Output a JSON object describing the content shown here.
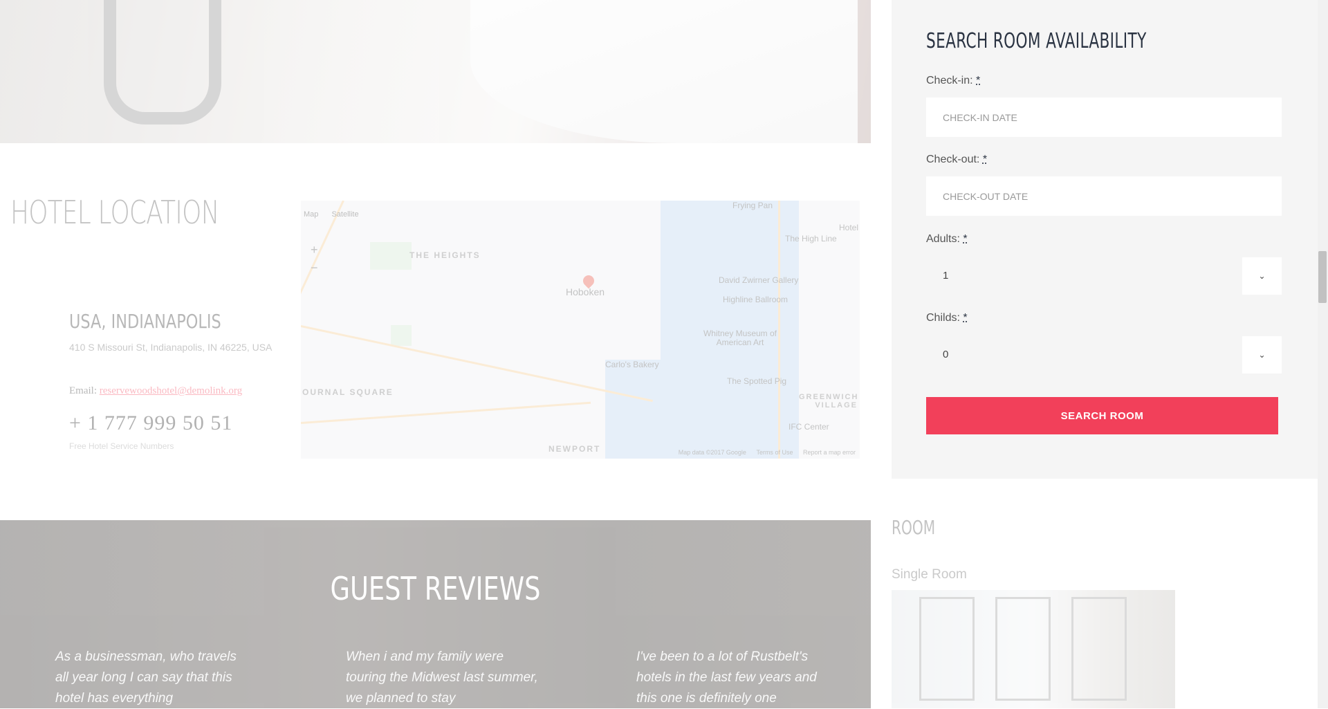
{
  "location": {
    "title": "HOTEL LOCATION",
    "city": "USA, INDIANAPOLIS",
    "address": "410 S Missouri St, Indianapolis, IN 46225, USA",
    "email_label": "Email: ",
    "email": "reservewoodshotel@demolink.org",
    "phone_prefix": "+",
    "phone": "1 777 999 50 51",
    "phone_note": "Free Hotel Service Numbers"
  },
  "map": {
    "type_map": "Map",
    "type_satellite": "Satellite",
    "zoom_in": "+",
    "zoom_out": "−",
    "labels": {
      "heights": "THE HEIGHTS",
      "hoboken": "Hoboken",
      "journal_square": "OURNAL SQUARE",
      "newport": "NEWPORT",
      "high_line": "The High Line",
      "zwirner": "David Zwirner Gallery",
      "highline_ballroom": "Highline Ballroom",
      "whitney": "Whitney Museum of American Art",
      "carlos_bakery": "Carlo's Bakery",
      "spotted_pig": "The Spotted Pig",
      "greenwich_village": "GREENWICH VILLAGE",
      "ifc_center": "IFC Center",
      "hotel": "Hotel",
      "frying_pan": "Frying Pan"
    },
    "footer_data": "Map data ©2017 Google",
    "footer_terms": "Terms of Use",
    "footer_report": "Report a map error"
  },
  "reviews": {
    "title": "GUEST REVIEWS",
    "items": [
      "As a businessman, who travels all year long I can say that this hotel has everything",
      "When i and my family were touring the Midwest last summer, we planned to stay",
      "I've been to a lot of Rustbelt's hotels in the last few years and this one is definitely one"
    ]
  },
  "search": {
    "title": "SEARCH ROOM AVAILABILITY",
    "checkin_label": "Check-in:",
    "checkin_placeholder": "CHECK-IN DATE",
    "checkout_label": "Check-out:",
    "checkout_placeholder": "CHECK-OUT DATE",
    "adults_label": "Adults:",
    "adults_value": "1",
    "childs_label": "Childs:",
    "childs_value": "0",
    "required_mark": "*",
    "button_label": "SEARCH ROOM",
    "accent_color": "#f2405a"
  },
  "room": {
    "heading": "ROOM",
    "name": "Single Room"
  }
}
